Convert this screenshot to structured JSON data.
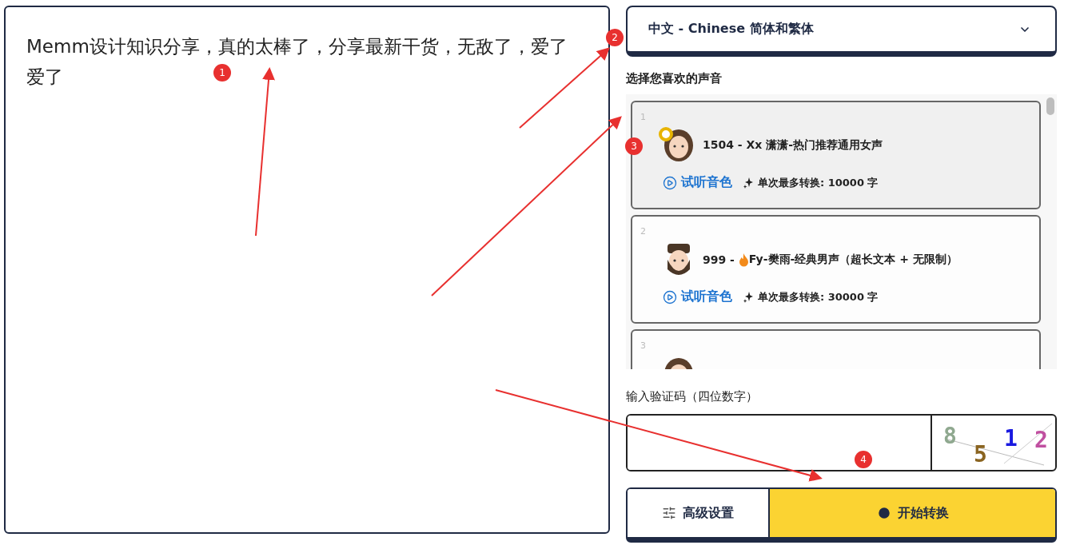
{
  "editor": {
    "value": "Memm设计知识分享，真的太棒了，分享最新干货，无敌了，爱了爱了"
  },
  "language_select": {
    "value": "中文 - Chinese 简体和繁体"
  },
  "voice_section": {
    "title": "选择您喜欢的声音"
  },
  "voices": [
    {
      "index": "1",
      "selected": true,
      "kind": "female",
      "prefix": "1504 -",
      "hot": false,
      "name": "Xx 潇潇-热门推荐通用女声",
      "preview": "试听音色",
      "limit": "单次最多转换: 10000 字"
    },
    {
      "index": "2",
      "selected": false,
      "kind": "male",
      "prefix": "999 -",
      "hot": true,
      "name": "Fy-樊雨-经典男声（超长文本 + 无限制）",
      "preview": "试听音色",
      "limit": "单次最多转换: 30000 字"
    },
    {
      "index": "3",
      "selected": false,
      "kind": "female"
    }
  ],
  "captcha": {
    "label": "输入验证码（四位数字）",
    "chars": [
      {
        "text": "8",
        "color": "#8fa88f"
      },
      {
        "text": "5",
        "color": "#8a6420"
      },
      {
        "text": "1",
        "color": "#1a1ae0"
      },
      {
        "text": "2",
        "color": "#c050a0"
      }
    ]
  },
  "buttons": [
    {
      "kind": "settings",
      "label": "高级设置"
    },
    {
      "kind": "start",
      "label": "开始转换"
    }
  ],
  "annotations": [
    {
      "label": "1"
    },
    {
      "label": "2"
    },
    {
      "label": "3"
    },
    {
      "label": "4"
    }
  ]
}
